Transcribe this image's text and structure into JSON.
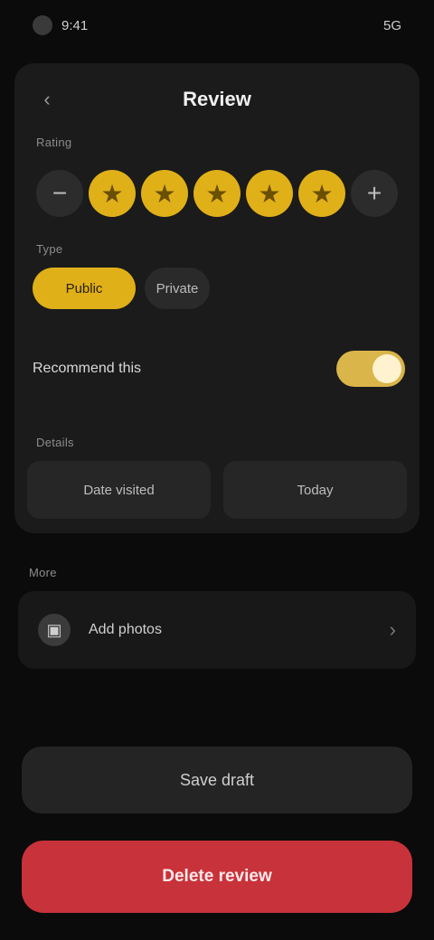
{
  "status": {
    "time": "9:41",
    "right": "5G"
  },
  "header": {
    "back_icon": "chevron-left-icon",
    "title": "Review"
  },
  "rating": {
    "label": "Rating",
    "minus": "−",
    "plus": "+",
    "stars": [
      "★",
      "★",
      "★",
      "★",
      "★"
    ],
    "value": 5,
    "max": 5
  },
  "segments": {
    "label": "Type",
    "items": [
      "Public",
      "Private"
    ],
    "active_index": 0
  },
  "toggle": {
    "label": "Recommend this",
    "on": true
  },
  "fields": {
    "label": "Details",
    "left": "Date visited",
    "right": "Today"
  },
  "list": {
    "label": "More",
    "icon": "photo-icon",
    "item": "Add photos",
    "chevron": "›"
  },
  "buttons": {
    "secondary": "Save draft",
    "danger": "Delete review"
  },
  "colors": {
    "accent": "#e0b019",
    "danger": "#c8323a",
    "surface": "#1b1b1b"
  }
}
